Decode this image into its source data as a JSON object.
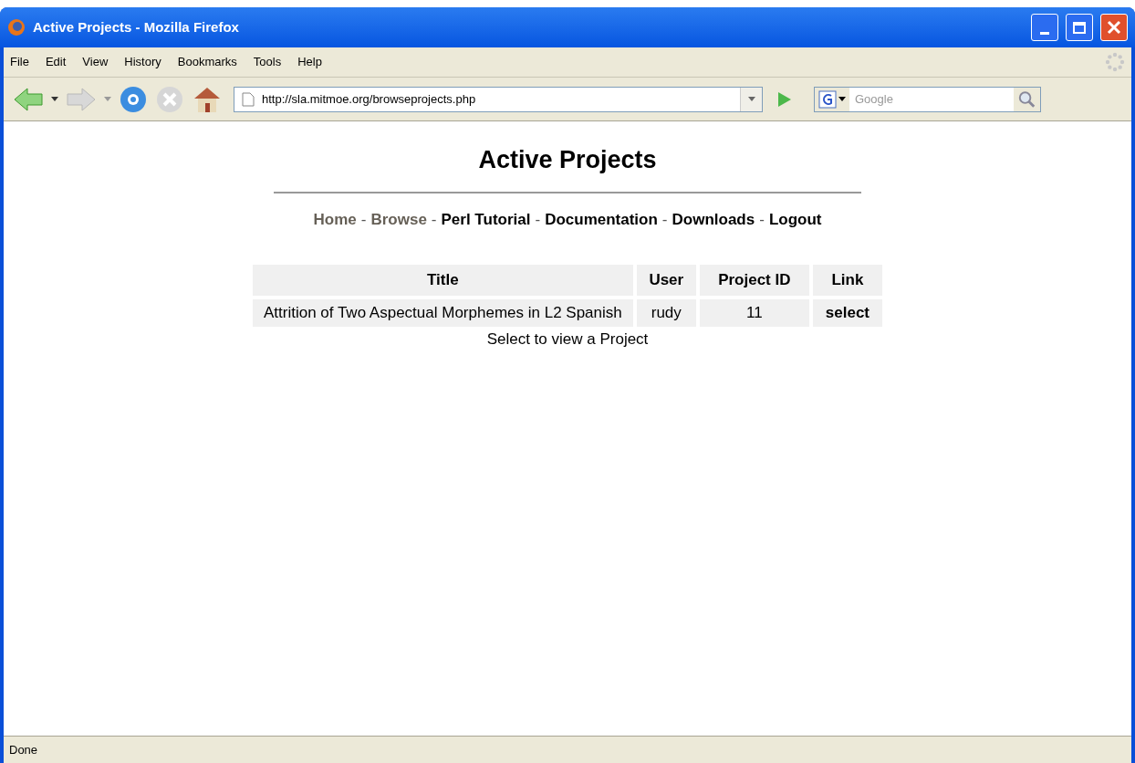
{
  "window": {
    "title": "Active Projects - Mozilla Firefox"
  },
  "menu": [
    "File",
    "Edit",
    "View",
    "History",
    "Bookmarks",
    "Tools",
    "Help"
  ],
  "address": {
    "url": "http://sla.mitmoe.org/browseprojects.php"
  },
  "search": {
    "placeholder": "Google"
  },
  "page": {
    "heading": "Active Projects",
    "nav": [
      {
        "label": "Home",
        "visited": true
      },
      {
        "label": "Browse",
        "visited": true
      },
      {
        "label": "Perl Tutorial",
        "visited": false
      },
      {
        "label": "Documentation",
        "visited": false
      },
      {
        "label": "Downloads",
        "visited": false
      },
      {
        "label": "Logout",
        "visited": false
      }
    ],
    "nav_separator": "-",
    "table": {
      "columns": [
        "Title",
        "User",
        "Project ID",
        "Link"
      ],
      "rows": [
        {
          "title": "Attrition of Two Aspectual Morphemes in L2 Spanish",
          "user": "rudy",
          "project_id": "11",
          "link": "select"
        }
      ]
    },
    "footnote": "Select to view a Project"
  },
  "status_bar": "Done"
}
